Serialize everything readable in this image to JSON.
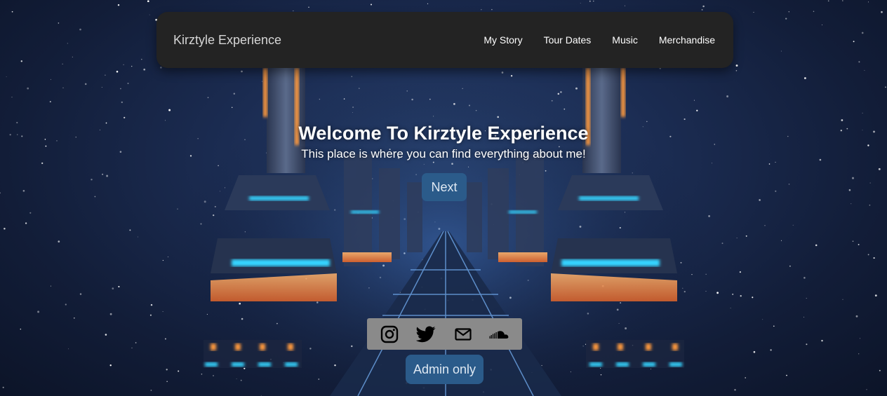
{
  "navbar": {
    "brand": "Kirztyle Experience",
    "links": [
      "My Story",
      "Tour Dates",
      "Music",
      "Merchandise"
    ]
  },
  "hero": {
    "title": "Welcome To Kirztyle Experience",
    "subtitle": "This place is where you can find everything about me!",
    "next_label": "Next"
  },
  "social": {
    "icons": [
      "instagram-icon",
      "twitter-icon",
      "mail-icon",
      "soundcloud-icon"
    ]
  },
  "admin": {
    "label": "Admin only"
  },
  "colors": {
    "navbar_bg": "#232323",
    "button_bg": "#2b5b8a",
    "social_bar_bg": "#8a8a8a",
    "neon_cyan": "#36d4ff",
    "neon_orange": "#ff9a3c"
  }
}
